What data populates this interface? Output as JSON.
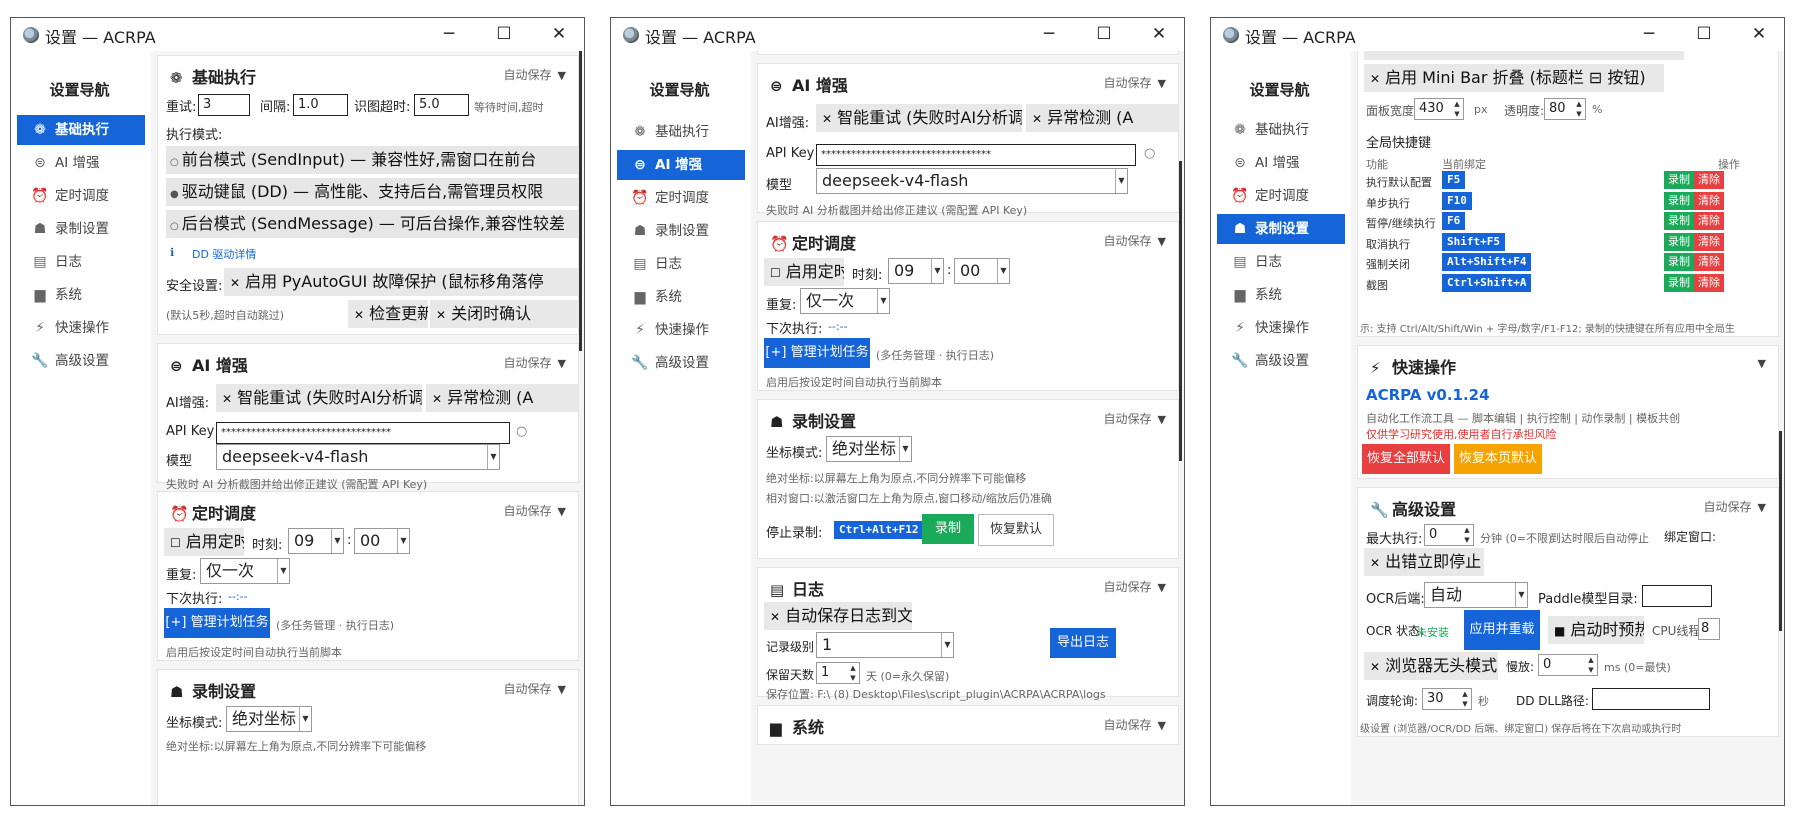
{
  "window": {
    "title": "设置 — ACRPA",
    "minimize": "─",
    "maximize": "☐",
    "close": "✕"
  },
  "nav": {
    "title": "设置导航",
    "items": [
      {
        "icon": "❁",
        "label": "基础执行"
      },
      {
        "icon": "⊜",
        "label": "AI 增强"
      },
      {
        "icon": "⏰",
        "label": "定时调度"
      },
      {
        "icon": "☗",
        "label": "录制设置"
      },
      {
        "icon": "▤",
        "label": "日志"
      },
      {
        "icon": "▆",
        "label": "系统"
      },
      {
        "icon": "⚡",
        "label": "快速操作"
      },
      {
        "icon": "🔧",
        "label": "高级设置"
      }
    ]
  },
  "autosave": "自动保存",
  "collapse": "▼",
  "basic": {
    "title": "基础执行",
    "retry_label": "重试:",
    "retry": "3",
    "interval_label": "间隔:",
    "interval": "1.0",
    "timeout_label": "识图超时:",
    "timeout": "5.0",
    "wait_hint": "等待时间,超时",
    "mode_label": "执行模式:",
    "mode1": "前台模式 (SendInput) — 兼容性好,需窗口在前台",
    "mode2": "驱动键鼠 (DD) — 高性能、支持后台,需管理员权限",
    "mode3": "后台模式 (SendMessage) — 可后台操作,兼容性较差",
    "dd_link": "DD 驱动详情",
    "safety_label": "安全设置:",
    "safety_chip": "启用 PyAutoGUI 故障保护 (鼠标移角落停",
    "safety_hint": "(默认5秒,超时自动跳过)",
    "check_update": "检查更新",
    "close_confirm": "关闭时确认"
  },
  "ai": {
    "title": "AI 增强",
    "label": "AI增强:",
    "chip1": "智能重试 (失败时AI分析调整)",
    "chip2": "异常检测 (A",
    "apikey_label": "API Key",
    "apikey": "**********************************",
    "model_label": "模型",
    "model": "deepseek-v4-flash",
    "hint": "失败时 AI 分析截图并给出修正建议 (需配置 API Key)"
  },
  "schedule": {
    "title": "定时调度",
    "enable": "启用定时",
    "time_label": "时刻:",
    "hour": "09",
    "colon": ":",
    "minute": "00",
    "repeat_label": "重复:",
    "repeat": "仅一次",
    "next_label": "下次执行:",
    "next": "--:--",
    "manage_btn": "[+] 管理计划任务",
    "manage_hint": "(多任务管理 · 执行日志)",
    "hint": "启用后按设定时间自动执行当前脚本"
  },
  "record": {
    "title": "录制设置",
    "coord_label": "坐标模式:",
    "coord": "绝对坐标",
    "abs_hint": "绝对坐标:以屏幕左上角为原点,不同分辨率下可能偏移",
    "rel_hint": "相对窗口:以激活窗口左上角为原点,窗口移动/缩放后仍准确",
    "stop_label": "停止录制:",
    "stop_key": "Ctrl+Alt+F12",
    "record_btn": "录制",
    "reset_btn": "恢复默认"
  },
  "log": {
    "title": "日志",
    "autosave_chip": "自动保存日志到文件",
    "level_label": "记录级别",
    "level": "1",
    "export_btn": "导出日志",
    "keep_label": "保留天数",
    "keep": "1",
    "keep_hint": "天 (0=永久保留)",
    "path": "保存位置: F:\\ (8) Desktop\\Files\\script_plugin\\ACRPA\\ACRPA\\logs"
  },
  "system": {
    "title": "系统"
  },
  "panel": {
    "top_chip": "启用 Mini Bar 折叠 (标题栏 ⊟ 按钮)",
    "width_label": "面板宽度:",
    "width": "430",
    "width_unit": "px",
    "opacity_label": "透明度:",
    "opacity": "80",
    "opacity_unit": "%"
  },
  "hotkeys": {
    "title": "全局快捷键",
    "col_func": "功能",
    "col_bind": "当前绑定",
    "col_op": "操作",
    "record": "录制",
    "clear": "清除",
    "rows": [
      {
        "func": "执行默认配置",
        "key": "F5"
      },
      {
        "func": "单步执行",
        "key": "F10"
      },
      {
        "func": "暂停/继续执行",
        "key": "F6"
      },
      {
        "func": "取消执行",
        "key": "Shift+F5"
      },
      {
        "func": "强制关闭",
        "key": "Alt+Shift+F4"
      },
      {
        "func": "截图",
        "key": "Ctrl+Shift+A"
      }
    ],
    "hint": "示: 支持 Ctrl/Alt/Shift/Win + 字母/数字/F1-F12; 录制的快捷键在所有应用中全局生"
  },
  "quick": {
    "title": "快速操作",
    "version": "ACRPA v0.1.24",
    "desc": "自动化工作流工具 — 脚本编辑 | 执行控制 | 动作录制 | 模板共创",
    "warn": "仅供学习研究使用,使用者自行承担风险",
    "reset_all": "恢复全部默认",
    "reset_page": "恢复本页默认"
  },
  "advanced": {
    "title": "高级设置",
    "maxexec_label": "最大执行:",
    "maxexec": "0",
    "maxexec_hint": "分钟 (0=不限)",
    "maxexec_hint2": "到达时限后自动停止",
    "bind_label": "绑定窗口:",
    "stop_chip": "出错立即停止",
    "ocr_label": "OCR后端:",
    "ocr": "自动",
    "paddle_label": "Paddle模型目录:",
    "ocr_status_label": "OCR 状态:",
    "ocr_status": "未安装",
    "apply_btn": "应用并重载",
    "preheat": "启动时预热",
    "cpu_label": "CPU线程:",
    "cpu": "8",
    "headless_chip": "浏览器无头模式",
    "slow_label": "慢放:",
    "slow": "0",
    "slow_hint": "ms (0=最快)",
    "poll_label": "调度轮询:",
    "poll": "30",
    "poll_unit": "秒",
    "dll_label": "DD DLL路径:",
    "footer": "级设置 (浏览器/OCR/DD 后端、绑定窗口) 保存后将在下次启动或执行时"
  },
  "colors": {
    "accent": "#1565d8",
    "green": "#1aaa5a",
    "red": "#e84040",
    "orange": "#f5a300"
  }
}
